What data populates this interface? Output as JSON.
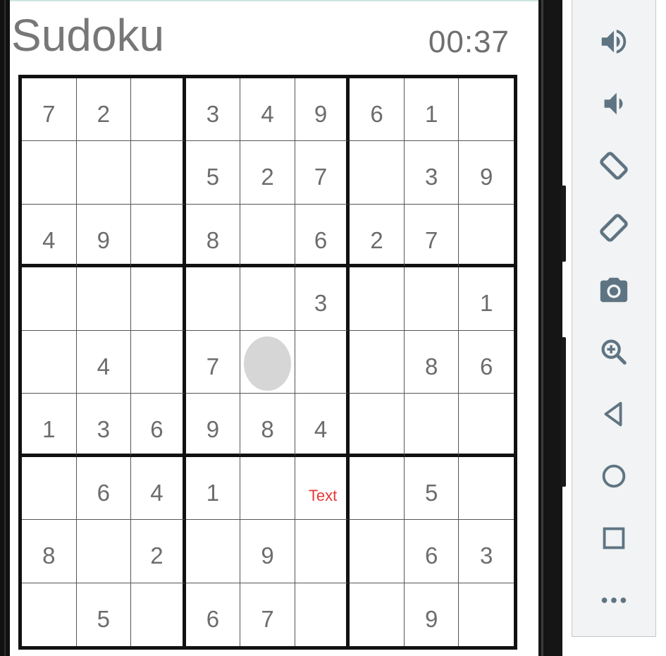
{
  "app": {
    "title": "Sudoku",
    "timer": "00:37"
  },
  "board": {
    "rows": [
      [
        "7",
        "2",
        "",
        "3",
        "4",
        "9",
        "6",
        "1",
        ""
      ],
      [
        "",
        "",
        "",
        "5",
        "2",
        "7",
        "",
        "3",
        "9"
      ],
      [
        "4",
        "9",
        "",
        "8",
        "",
        "6",
        "2",
        "7",
        ""
      ],
      [
        "",
        "",
        "",
        "",
        "",
        "3",
        "",
        "",
        "1"
      ],
      [
        "",
        "4",
        "",
        "7",
        "",
        "",
        "",
        "8",
        "6"
      ],
      [
        "1",
        "3",
        "6",
        "9",
        "8",
        "4",
        "",
        "",
        ""
      ],
      [
        "",
        "6",
        "4",
        "1",
        "",
        "Text",
        "",
        "5",
        ""
      ],
      [
        "8",
        "",
        "2",
        "",
        "9",
        "",
        "",
        "6",
        "3"
      ],
      [
        "",
        "5",
        "",
        "6",
        "7",
        "",
        "",
        "9",
        ""
      ]
    ],
    "highlight_text": "Text",
    "highlight_color": "#e53935",
    "digit_color": "#6c6c6c"
  },
  "emulator_toolbar": {
    "buttons": [
      {
        "name": "volume-up-icon"
      },
      {
        "name": "volume-down-icon"
      },
      {
        "name": "rotate-left-icon"
      },
      {
        "name": "rotate-right-icon"
      },
      {
        "name": "camera-icon"
      },
      {
        "name": "zoom-icon"
      },
      {
        "name": "back-icon"
      },
      {
        "name": "home-icon"
      },
      {
        "name": "overview-icon"
      },
      {
        "name": "more-icon"
      }
    ],
    "icon_color": "#5f7482"
  }
}
